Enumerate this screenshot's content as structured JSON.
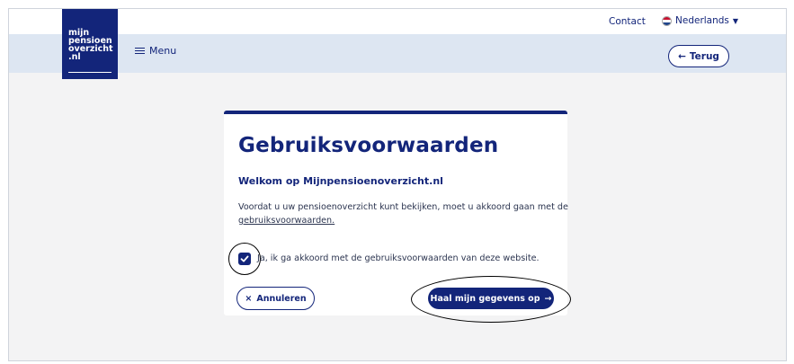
{
  "header": {
    "logo_lines": [
      "mijn",
      "pensioen",
      "overzicht",
      ".nl"
    ],
    "menu_label": "Menu",
    "contact_label": "Contact",
    "language_label": "Nederlands",
    "back_label": "Terug"
  },
  "card": {
    "title": "Gebruiksvoorwaarden",
    "subtitle": "Welkom op Mijnpensioenoverzicht.nl",
    "intro_text": "Voordat u uw pensioenoverzicht kunt bekijken, moet u akkoord gaan met de ",
    "terms_link": "gebruiksvoorwaarden.",
    "checkbox_label": "Ja, ik ga akkoord met de gebruiksvoorwaarden van deze website.",
    "checkbox_checked": true,
    "cancel_label": "Annuleren",
    "submit_label": "Haal mijn gegevens op"
  },
  "colors": {
    "brand": "#13257a",
    "navbar": "#dde6f2",
    "page_bg": "#f3f3f4"
  },
  "icons": {
    "menu": "hamburger-icon",
    "language": "dutch-flag-icon",
    "dropdown": "chevron-down-icon",
    "back": "arrow-left-icon",
    "cancel": "close-icon",
    "submit": "arrow-right-icon",
    "checkbox": "checkmark-icon"
  }
}
